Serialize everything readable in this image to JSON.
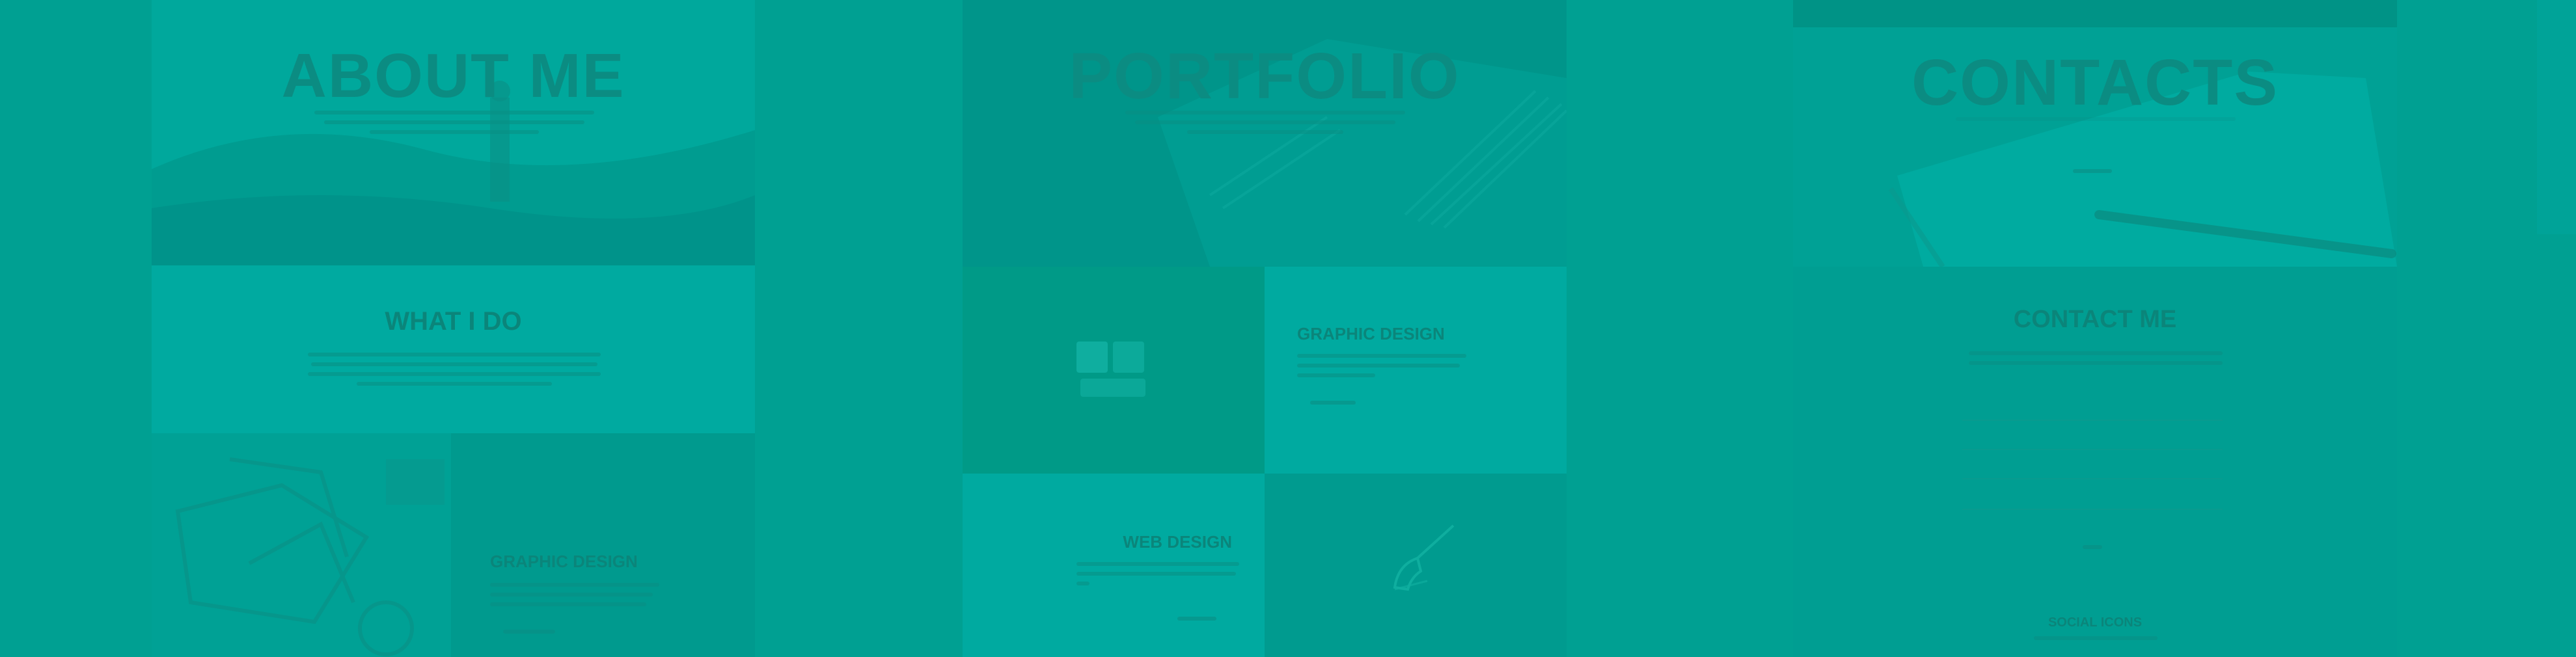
{
  "page": {
    "background": "#00a092",
    "accent": "#00aba0"
  },
  "about": {
    "title": "ABOUT ME",
    "what_i_do": "WHAT I DO",
    "feature_title": "GRAPHIC DESIGN"
  },
  "portfolio": {
    "title": "PORTFOLIO",
    "tile1_title": "GRAPHIC DESIGN",
    "tile2_title": "WEB DESIGN"
  },
  "contacts": {
    "title": "CONTACTS",
    "form_title": "CONTACT ME",
    "footer_title": "SOCIAL ICONS"
  },
  "icons": {
    "portfolio_graphic_icon": "layers-icon",
    "portfolio_web_icon": "pen-icon"
  }
}
